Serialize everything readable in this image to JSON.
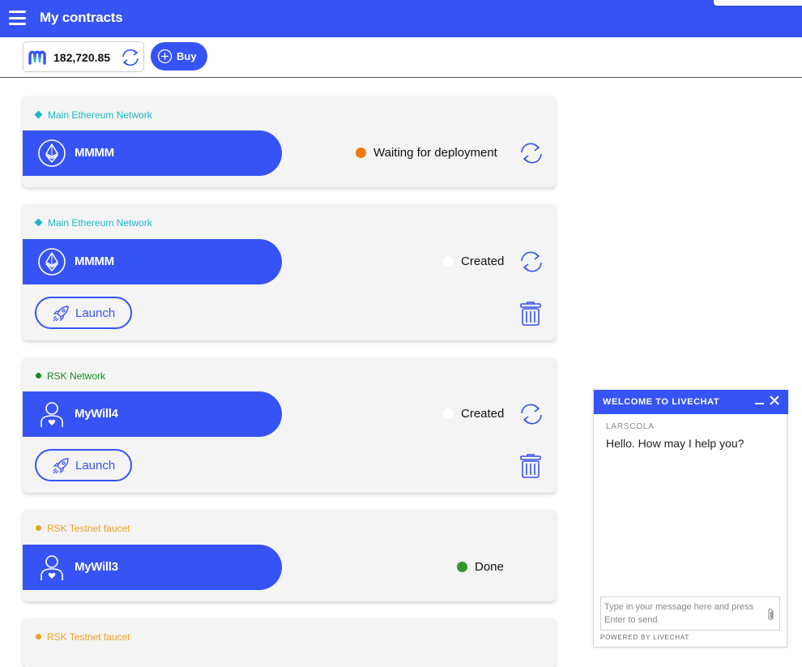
{
  "header": {
    "title": "My contracts"
  },
  "balance": {
    "value": "182,720.85",
    "buy_label": "Buy"
  },
  "colors": {
    "brand": "#3653f5",
    "ethereum_net": "#1bb8c5",
    "rsk_net": "#148a1d",
    "testnet": "#f0a11f",
    "waiting": "#f07b10",
    "done": "#2b9a2b"
  },
  "contracts": [
    {
      "network": "Main Ethereum Network",
      "network_icon": "diamond",
      "name": "MMMM",
      "icon": "ethereum-icon",
      "status": "Waiting for deployment"
    },
    {
      "network": "Main Ethereum Network",
      "network_icon": "diamond",
      "name": "MMMM",
      "icon": "ethereum-icon",
      "status": "Created",
      "action": "Launch"
    },
    {
      "network": "RSK Network",
      "network_icon": "dot",
      "name": "MyWill4",
      "icon": "will-user-icon",
      "status": "Created",
      "action": "Launch"
    },
    {
      "network": "RSK Testnet faucet",
      "network_icon": "dot",
      "name": "MyWill3",
      "icon": "will-user-icon",
      "status": "Done"
    },
    {
      "network": "RSK Testnet faucet",
      "network_icon": "dot"
    }
  ],
  "livechat": {
    "title": "WELCOME TO LIVECHAT",
    "agent": "LARSCOLA",
    "message": "Hello. How may I help you?",
    "placeholder": "Type in your message here and press Enter to send",
    "powered": "POWERED BY LIVECHAT"
  }
}
